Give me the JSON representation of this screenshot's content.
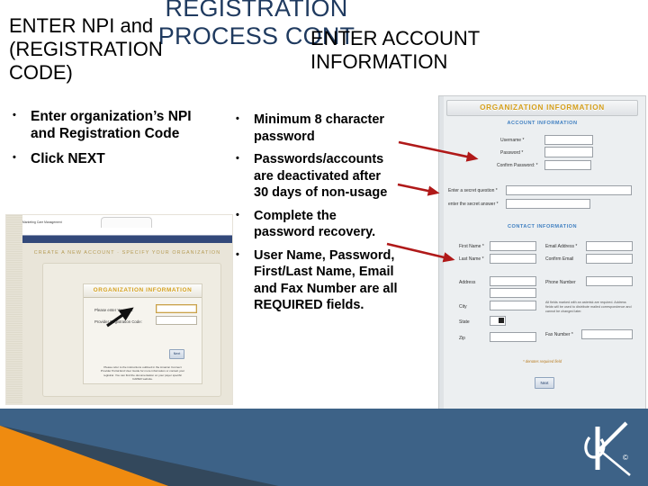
{
  "slide": {
    "title_main": "REGISTRATION PROCESS CONT",
    "title_left": "ENTER NPI and (REGISTRATION CODE)",
    "title_right": "ENTER ACCOUNT INFORMATION",
    "title_color": "#1F3A5F",
    "accent_orange": "#EF8B10",
    "accent_blue": "#3D6287",
    "accent_dark": "#33485C",
    "arrow_red": "#B01919",
    "arrow_black": "#111111"
  },
  "columns": {
    "left": {
      "bullets": [
        "Enter organization’s NPI and Registration Code",
        "Click NEXT"
      ]
    },
    "middle": {
      "bullets": [
        "Minimum 8 character password",
        "Passwords/accounts are deactivated after 30 days of non-usage",
        "Complete the password recovery.",
        "User Name, Password, First/Last Name, Email and Fax Number are all REQUIRED fields."
      ]
    }
  },
  "left_screenshot": {
    "brand": "Marketing Care Management",
    "breadcrumb": "CREATE A NEW ACCOUNT · SPECIFY YOUR ORGANIZATION",
    "panel_title": "ORGANIZATION INFORMATION",
    "fields": [
      {
        "label": "Please enter Your NPI:",
        "value": "",
        "focused": true
      },
      {
        "label": "Provider Registration Code:",
        "value": "",
        "focused": false
      }
    ],
    "next_label": "Next",
    "footnote": "Please refer to the instructions outlined in the Amazon Connect Provider Portal End User Guide for more information or contact your registrar. You can find the documentation on your payer specific CAPER website."
  },
  "right_screenshot": {
    "panel_title": "ORGANIZATION INFORMATION",
    "section_account": "ACCOUNT INFORMATION",
    "section_contact": "CONTACT INFORMATION",
    "account_fields": [
      {
        "label": "Username *",
        "value": ""
      },
      {
        "label": "Password *",
        "value": ""
      },
      {
        "label": "Confirm Password: *",
        "value": ""
      }
    ],
    "secret_fields": [
      {
        "label": "Enter a secret question *",
        "value": ""
      },
      {
        "label": "enter the secret answer *",
        "value": ""
      }
    ],
    "contact_left": [
      {
        "label": "First Name *",
        "value": ""
      },
      {
        "label": "Last Name *",
        "value": ""
      },
      {
        "label": "Address",
        "value": ""
      },
      {
        "label": "",
        "value": ""
      },
      {
        "label": "City",
        "value": ""
      },
      {
        "label": "State",
        "value": "-"
      },
      {
        "label": "Zip",
        "value": ""
      }
    ],
    "contact_right": [
      {
        "label": "Email Address *",
        "value": ""
      },
      {
        "label": "Confirm Email",
        "value": ""
      },
      {
        "label": "Phone Number",
        "value": ""
      },
      {
        "label": "Fax Number *",
        "value": ""
      }
    ],
    "note": "All fields marked with an asterisk are required. Address fields will be used to distribute mailed correspondence and cannot be changed later.",
    "required_note": "* denotes required field",
    "next_label": "Next"
  },
  "logo": {
    "mark": "K",
    "copyright": "©"
  }
}
